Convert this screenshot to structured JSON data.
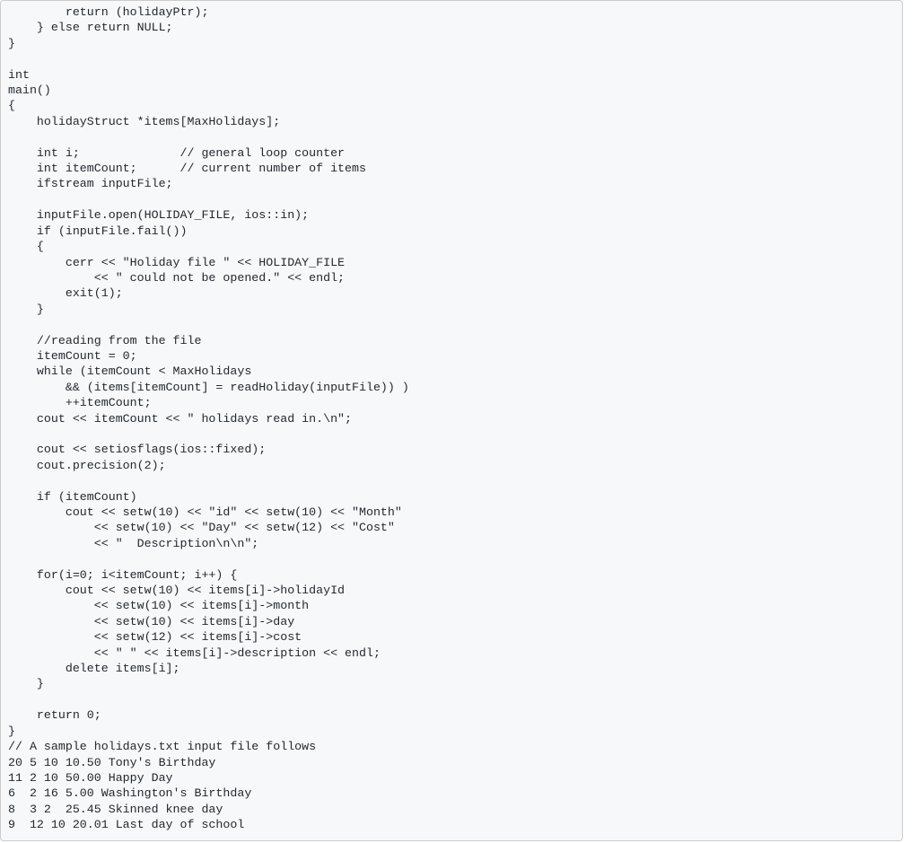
{
  "code_lines": [
    "        return (holidayPtr);",
    "    } else return NULL;",
    "}",
    "",
    "int",
    "main()",
    "{",
    "    holidayStruct *items[MaxHolidays];",
    "",
    "    int i;              // general loop counter",
    "    int itemCount;      // current number of items",
    "    ifstream inputFile;",
    "",
    "    inputFile.open(HOLIDAY_FILE, ios::in);",
    "    if (inputFile.fail())",
    "    {",
    "        cerr << \"Holiday file \" << HOLIDAY_FILE",
    "            << \" could not be opened.\" << endl;",
    "        exit(1);",
    "    }",
    "",
    "    //reading from the file",
    "    itemCount = 0;",
    "    while (itemCount < MaxHolidays",
    "        && (items[itemCount] = readHoliday(inputFile)) )",
    "        ++itemCount;",
    "    cout << itemCount << \" holidays read in.\\n\";",
    "",
    "    cout << setiosflags(ios::fixed);",
    "    cout.precision(2);",
    "",
    "    if (itemCount)",
    "        cout << setw(10) << \"id\" << setw(10) << \"Month\"",
    "            << setw(10) << \"Day\" << setw(12) << \"Cost\"",
    "            << \"  Description\\n\\n\";",
    "",
    "    for(i=0; i<itemCount; i++) {",
    "        cout << setw(10) << items[i]->holidayId",
    "            << setw(10) << items[i]->month",
    "            << setw(10) << items[i]->day",
    "            << setw(12) << items[i]->cost",
    "            << \" \" << items[i]->description << endl;",
    "        delete items[i];",
    "    }",
    "",
    "    return 0;",
    "}",
    "// A sample holidays.txt input file follows",
    "20 5 10 10.50 Tony's Birthday",
    "11 2 10 50.00 Happy Day",
    "6  2 16 5.00 Washington's Birthday",
    "8  3 2  25.45 Skinned knee day",
    "9  12 10 20.01 Last day of school"
  ]
}
